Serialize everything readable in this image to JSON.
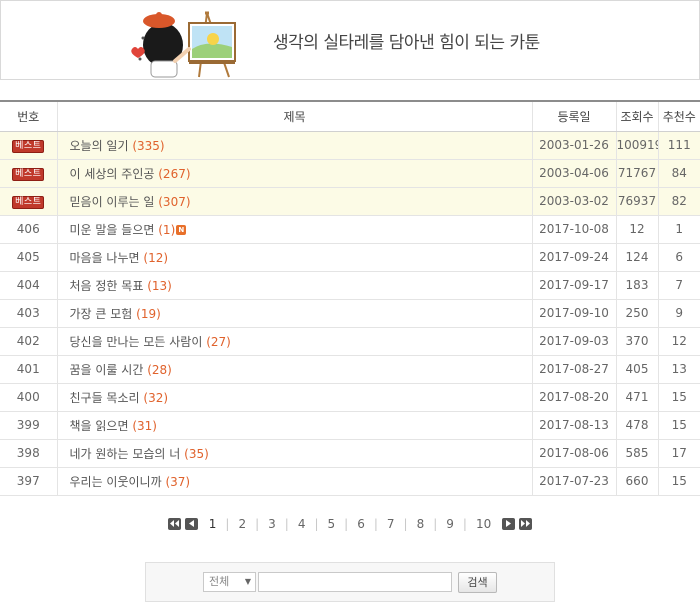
{
  "banner": {
    "tagline": "생각의 실타레를 담아낸 힘이 되는 카툰"
  },
  "table": {
    "headers": {
      "no": "번호",
      "title": "제목",
      "date": "등록일",
      "views": "조회수",
      "recommend": "추천수"
    },
    "best_badge": "베스트",
    "best_rows": [
      {
        "title": "오늘의 일기",
        "comments": "(335)",
        "date": "2003-01-26",
        "views": "100919",
        "recommend": "111"
      },
      {
        "title": "이 세상의 주인공",
        "comments": "(267)",
        "date": "2003-04-06",
        "views": "71767",
        "recommend": "84"
      },
      {
        "title": "믿음이 이루는 일",
        "comments": "(307)",
        "date": "2003-03-02",
        "views": "76937",
        "recommend": "82"
      }
    ],
    "rows": [
      {
        "no": "406",
        "title": "미운 말을 들으면",
        "comments": "(1)",
        "new": "N",
        "date": "2017-10-08",
        "views": "12",
        "recommend": "1"
      },
      {
        "no": "405",
        "title": "마음을 나누면",
        "comments": "(12)",
        "date": "2017-09-24",
        "views": "124",
        "recommend": "6"
      },
      {
        "no": "404",
        "title": "처음 정한 목표",
        "comments": "(13)",
        "date": "2017-09-17",
        "views": "183",
        "recommend": "7"
      },
      {
        "no": "403",
        "title": "가장 큰 모험",
        "comments": "(19)",
        "date": "2017-09-10",
        "views": "250",
        "recommend": "9"
      },
      {
        "no": "402",
        "title": "당신을 만나는 모든 사람이",
        "comments": "(27)",
        "date": "2017-09-03",
        "views": "370",
        "recommend": "12"
      },
      {
        "no": "401",
        "title": "꿈을 이룰 시간",
        "comments": "(28)",
        "date": "2017-08-27",
        "views": "405",
        "recommend": "13"
      },
      {
        "no": "400",
        "title": "친구들 목소리",
        "comments": "(32)",
        "date": "2017-08-20",
        "views": "471",
        "recommend": "15"
      },
      {
        "no": "399",
        "title": "책을 읽으면",
        "comments": "(31)",
        "date": "2017-08-13",
        "views": "478",
        "recommend": "15"
      },
      {
        "no": "398",
        "title": "네가 원하는 모습의 너",
        "comments": "(35)",
        "date": "2017-08-06",
        "views": "585",
        "recommend": "17"
      },
      {
        "no": "397",
        "title": "우리는 이웃이니까",
        "comments": "(37)",
        "date": "2017-07-23",
        "views": "660",
        "recommend": "15"
      }
    ]
  },
  "pagination": {
    "pages": [
      "1",
      "2",
      "3",
      "4",
      "5",
      "6",
      "7",
      "8",
      "9",
      "10"
    ],
    "current": "1",
    "icons": [
      "first-page-icon",
      "prev-page-icon",
      "next-page-icon",
      "last-page-icon"
    ]
  },
  "search": {
    "scope_selected": "전체",
    "query_value": "",
    "button_label": "검색"
  },
  "colors": {
    "best_row_bg": "#fcfbe6",
    "badge_red": "#c0392b",
    "comment_count": "#e0622c",
    "header_border": "#8c8c8c"
  }
}
